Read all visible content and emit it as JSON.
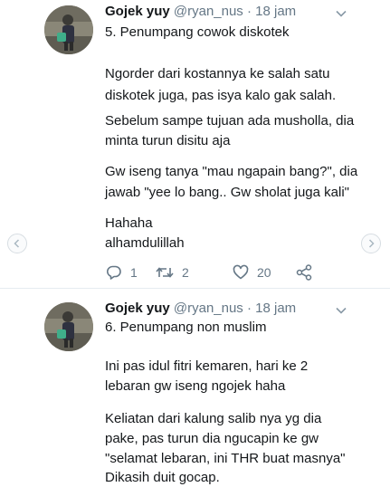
{
  "tweets": [
    {
      "name": "Gojek yuy",
      "handle": "@ryan_nus",
      "separator": "·",
      "time": "18 jam",
      "lines": [
        "5. Penumpang cowok diskotek",
        "Ngorder dari kostannya ke salah satu",
        "diskotek juga, pas isya kalo gak salah.",
        "Sebelum sampe tujuan ada musholla, dia",
        "minta turun disitu aja",
        "Gw iseng tanya \"mau ngapain bang?\", dia",
        "jawab \"yee lo bang.. Gw sholat juga kali\"",
        "Hahaha",
        "alhamdulillah"
      ],
      "actions": {
        "replies": "1",
        "retweets": "2",
        "likes": "20"
      },
      "icons": [
        "reply-icon",
        "retweet-icon",
        "like-icon",
        "share-icon",
        "chevron-down-icon"
      ]
    },
    {
      "name": "Gojek yuy",
      "handle": "@ryan_nus",
      "separator": "·",
      "time": "18 jam",
      "lines": [
        "6. Penumpang non muslim",
        "Ini pas idul fitri kemaren, hari ke 2",
        "lebaran gw iseng ngojek haha",
        "Keliatan dari kalung salib nya yg dia",
        "pake, pas turun dia ngucapin ke gw",
        "\"selamat lebaran, ini THR buat masnya\"",
        "Dikasih duit gocap."
      ]
    }
  ],
  "colors": {
    "text": "#14171a",
    "secondary": "#657786",
    "divider": "#e6ecf0"
  }
}
